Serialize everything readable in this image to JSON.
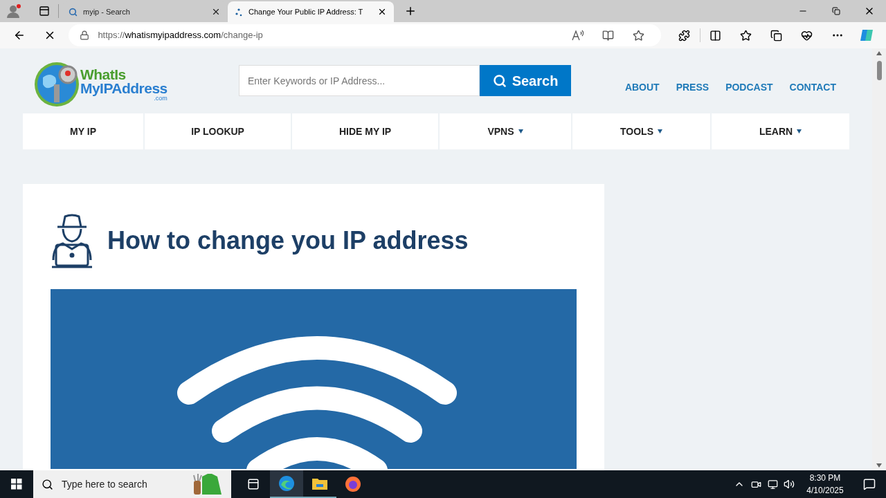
{
  "browser": {
    "tabs": [
      {
        "title": "myip - Search",
        "kind": "search",
        "selected": false
      },
      {
        "title": "Change Your Public IP Address: T",
        "kind": "loading",
        "selected": true
      }
    ],
    "address": {
      "scheme": "https://",
      "host": "whatismyipaddress.com",
      "path": "/change-ip"
    }
  },
  "site": {
    "logo": {
      "line1": "WhatIs",
      "line2": "MyIPAddress",
      "suffix": ".com"
    },
    "search": {
      "placeholder": "Enter Keywords or IP Address...",
      "button": "Search"
    },
    "top_links": [
      "ABOUT",
      "PRESS",
      "PODCAST",
      "CONTACT"
    ],
    "nav": [
      {
        "label": "MY IP",
        "has_menu": false
      },
      {
        "label": "IP LOOKUP",
        "has_menu": false
      },
      {
        "label": "HIDE MY IP",
        "has_menu": false
      },
      {
        "label": "VPNS",
        "has_menu": true
      },
      {
        "label": "TOOLS",
        "has_menu": true
      },
      {
        "label": "LEARN",
        "has_menu": true
      }
    ],
    "heading": "How to change you IP address"
  },
  "taskbar": {
    "search_placeholder": "Type here to search",
    "time": "8:30 PM",
    "date": "4/10/2025"
  }
}
